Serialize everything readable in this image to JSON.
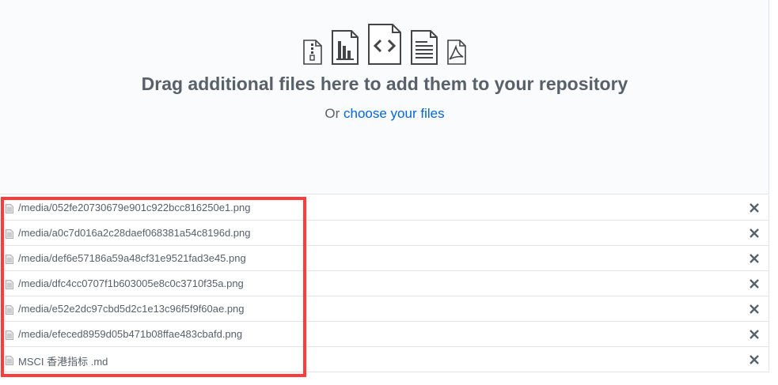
{
  "dropzone": {
    "file_type_icons": [
      "zip-file-icon",
      "chart-file-icon",
      "code-file-icon",
      "text-file-icon",
      "pdf-file-icon"
    ],
    "headline": "Drag additional files here to add them to your repository",
    "prefix": "Or ",
    "choose_link": "choose your files"
  },
  "files": [
    {
      "name": "/media/052fe20730679e901c922bcc816250e1.png"
    },
    {
      "name": "/media/a0c7d016a2c28daef068381a54c8196d.png"
    },
    {
      "name": "/media/def6e57186a59a48cf31e9521fad3e45.png"
    },
    {
      "name": "/media/dfc4cc0707f1b603005e8c0c3710f35a.png"
    },
    {
      "name": "/media/e52e2dc97cbd5d2c1e13c96f5f9f60ae.png"
    },
    {
      "name": "/media/efeced8959d05b471b08ffae483cbafd.png"
    },
    {
      "name": "MSCI 香港指标 .md"
    }
  ],
  "colors": {
    "link": "#0366d6",
    "text": "#586069",
    "highlight": "#ff3b3b",
    "border": "#e1e4e8"
  }
}
